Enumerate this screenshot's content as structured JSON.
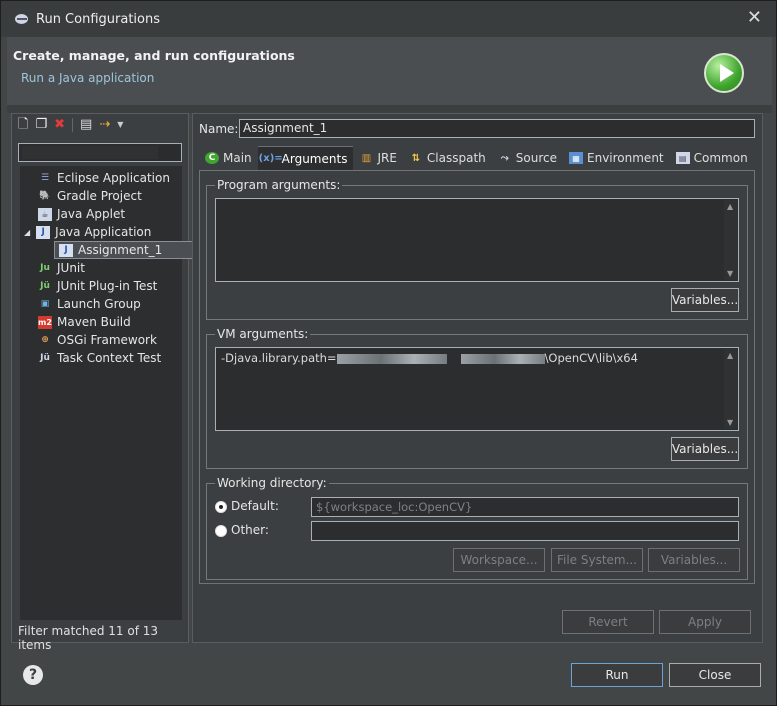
{
  "window": {
    "title": "Run Configurations",
    "close_glyph": "✕"
  },
  "banner": {
    "heading": "Create, manage, and run configurations",
    "subtitle": "Run a Java application"
  },
  "sidebar": {
    "filter_placeholder": "",
    "items": [
      {
        "label": "Eclipse Application",
        "icon": "eclipse-app-icon"
      },
      {
        "label": "Gradle Project",
        "icon": "gradle-icon"
      },
      {
        "label": "Java Applet",
        "icon": "java-applet-icon"
      },
      {
        "label": "Java Application",
        "icon": "java-app-icon",
        "expanded": true
      },
      {
        "label": "Assignment_1",
        "icon": "java-app-icon",
        "selected": true
      },
      {
        "label": "JUnit",
        "icon": "junit-icon"
      },
      {
        "label": "JUnit Plug-in Test",
        "icon": "junit-plugin-icon"
      },
      {
        "label": "Launch Group",
        "icon": "launch-group-icon"
      },
      {
        "label": "Maven Build",
        "icon": "maven-icon"
      },
      {
        "label": "OSGi Framework",
        "icon": "osgi-icon"
      },
      {
        "label": "Task Context Test",
        "icon": "task-context-icon"
      }
    ],
    "footer": "Filter matched 11 of 13 items"
  },
  "config": {
    "name_label": "Name:",
    "name_value": "Assignment_1",
    "tabs": [
      {
        "label": "Main"
      },
      {
        "label": "Arguments",
        "active": true
      },
      {
        "label": "JRE"
      },
      {
        "label": "Classpath"
      },
      {
        "label": "Source"
      },
      {
        "label": "Environment"
      },
      {
        "label": "Common"
      }
    ],
    "program_args": {
      "label": "Program arguments:",
      "value": "",
      "variables_label": "Variables..."
    },
    "vm_args": {
      "label": "VM arguments:",
      "value_prefix": "-Djava.library.path=",
      "value_suffix": "\\OpenCV\\lib\\x64",
      "variables_label": "Variables..."
    },
    "working_dir": {
      "label": "Working directory:",
      "default_label": "Default:",
      "default_value": "${workspace_loc:OpenCV}",
      "other_label": "Other:",
      "other_value": "",
      "workspace_label": "Workspace...",
      "filesystem_label": "File System...",
      "variables_label": "Variables..."
    },
    "revert_label": "Revert",
    "apply_label": "Apply"
  },
  "footer": {
    "run_label": "Run",
    "close_label": "Close",
    "help_glyph": "?"
  }
}
